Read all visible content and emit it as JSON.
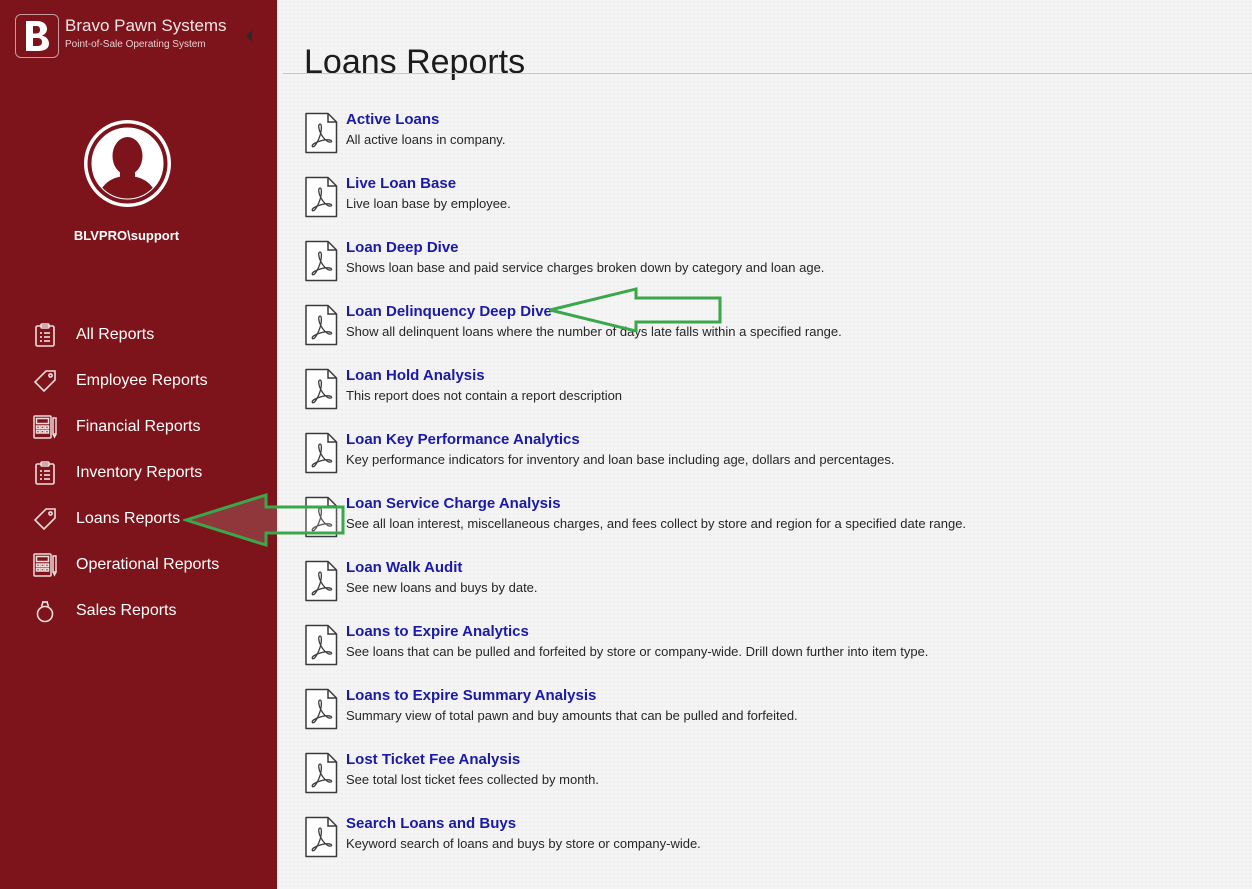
{
  "brand": {
    "name": "Bravo Pawn Systems",
    "subtitle": "Point-of-Sale Operating System",
    "logo_letter": "B"
  },
  "user": {
    "name": "BLVPRO\\support"
  },
  "sidebar": {
    "items": [
      {
        "label": "All Reports",
        "icon": "clipboard-list-icon"
      },
      {
        "label": "Employee Reports",
        "icon": "tag-icon"
      },
      {
        "label": "Financial Reports",
        "icon": "calculator-icon"
      },
      {
        "label": "Inventory Reports",
        "icon": "clipboard-list-icon"
      },
      {
        "label": "Loans Reports",
        "icon": "tag-icon",
        "highlighted": true
      },
      {
        "label": "Operational Reports",
        "icon": "calculator-icon"
      },
      {
        "label": "Sales Reports",
        "icon": "ring-icon"
      }
    ]
  },
  "page": {
    "title": "Loans Reports"
  },
  "reports": [
    {
      "title": "Active Loans",
      "description": "All active loans in company."
    },
    {
      "title": "Live Loan Base",
      "description": "Live loan base by employee."
    },
    {
      "title": "Loan Deep Dive",
      "description": "Shows loan base and paid service charges broken down by category and loan age."
    },
    {
      "title": "Loan Delinquency Deep Dive",
      "description": "Show all delinquent loans where the number of days late falls within a specified range.",
      "highlighted": true
    },
    {
      "title": "Loan Hold Analysis",
      "description": "This report does not contain a report description"
    },
    {
      "title": "Loan Key Performance Analytics",
      "description": "Key performance indicators for inventory and loan base including age, dollars and percentages."
    },
    {
      "title": "Loan Service Charge Analysis",
      "description": "See all loan interest, miscellaneous charges, and fees collect by store and region for a specified date range."
    },
    {
      "title": "Loan Walk Audit",
      "description": "See new loans and buys by date."
    },
    {
      "title": "Loans to Expire Analytics",
      "description": "See loans that can be pulled and forfeited by store or company-wide. Drill down further into item type."
    },
    {
      "title": "Loans to Expire Summary Analysis",
      "description": "Summary view of total pawn and buy amounts that can be pulled and forfeited."
    },
    {
      "title": "Lost Ticket Fee Analysis",
      "description": "See total lost ticket fees collected by month."
    },
    {
      "title": "Search Loans and Buys",
      "description": "Keyword search of loans and buys by store or company-wide."
    }
  ],
  "colors": {
    "sidebar_bg": "#7d141b",
    "link": "#1a1aa6",
    "annotation_arrow": "#3aa84a"
  }
}
